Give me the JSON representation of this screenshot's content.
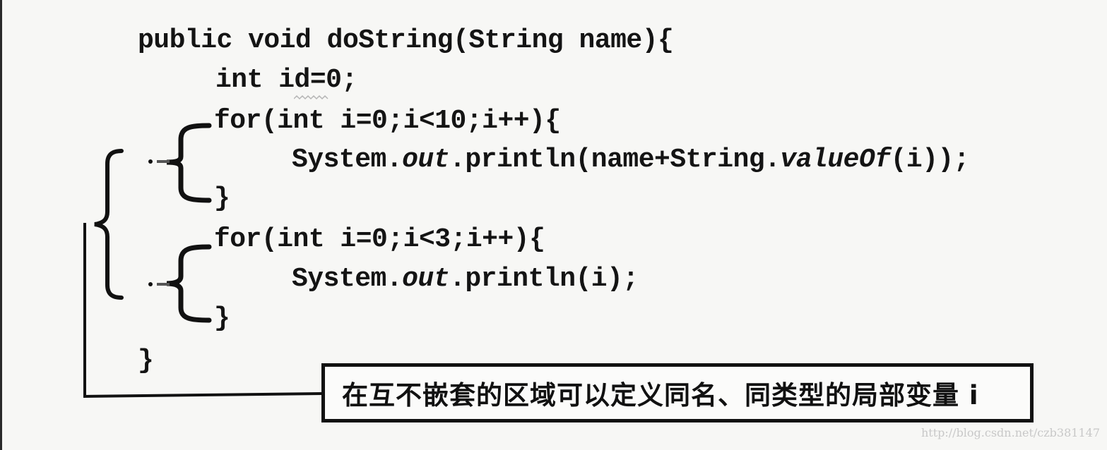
{
  "figure": {
    "type": "scanned-textbook-code-figure",
    "code": {
      "language": "java",
      "lines": [
        {
          "text": "public void doString(String name){"
        },
        {
          "text": "int id=0;"
        },
        {
          "text": "for(int i=0;i<10;i++){"
        },
        {
          "parts": [
            "System.",
            "out",
            ".println(name+String.",
            "valueOf",
            "(i));"
          ]
        },
        {
          "text": "}"
        },
        {
          "text": "for(int i=0;i<3;i++){"
        },
        {
          "parts": [
            "System.",
            "out",
            ".println(i);"
          ]
        },
        {
          "text": "}"
        },
        {
          "text": "}"
        }
      ]
    },
    "annotations": {
      "inner_brace_count": 2,
      "outer_brace_count": 1,
      "callout_text": "在互不嵌套的区域可以定义同名、同类型的局部变量 i"
    },
    "watermark": "http://blog.csdn.net/czb381147",
    "colors": {
      "paper": "#f7f7f5",
      "ink": "#141414",
      "watermark": "#c8c8c8"
    }
  }
}
